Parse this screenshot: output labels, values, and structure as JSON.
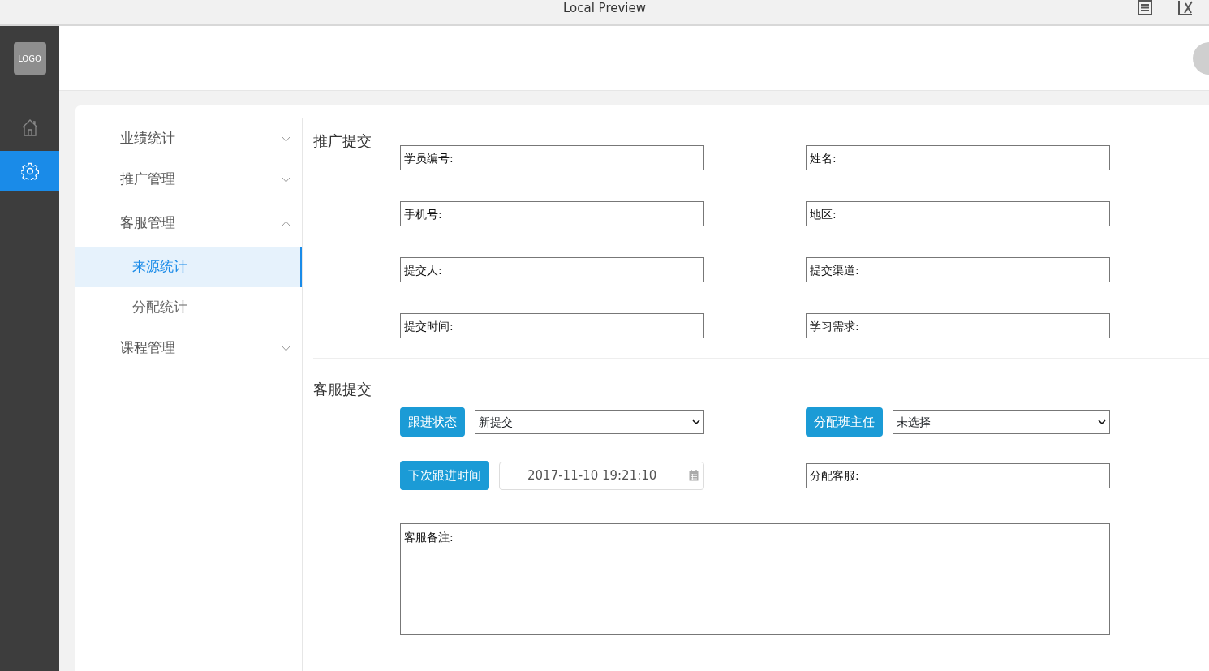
{
  "window": {
    "title": "Local Preview"
  },
  "sidebar": {
    "logo": "LOGO",
    "items": [
      {
        "kind": "home",
        "selected": false
      },
      {
        "kind": "settings",
        "selected": true
      }
    ]
  },
  "menu": [
    {
      "label": "业绩统计",
      "expanded": false
    },
    {
      "label": "推广管理",
      "expanded": false
    },
    {
      "label": "客服管理",
      "expanded": true,
      "children": [
        {
          "label": "来源统计",
          "selected": true
        },
        {
          "label": "分配统计",
          "selected": false
        }
      ]
    },
    {
      "label": "课程管理",
      "expanded": false
    }
  ],
  "promotion": {
    "title": "推广提交",
    "fields": [
      {
        "placeholder": "学员编号:"
      },
      {
        "placeholder": "姓名:"
      },
      {
        "placeholder": "手机号:"
      },
      {
        "placeholder": "地区:"
      },
      {
        "placeholder": "提交人:"
      },
      {
        "placeholder": "提交渠道:"
      },
      {
        "placeholder": "提交时间:"
      },
      {
        "placeholder": "学习需求:"
      }
    ]
  },
  "service": {
    "title": "客服提交",
    "controls": [
      {
        "kind": "select",
        "button": "跟进状态",
        "value": "新提交"
      },
      {
        "kind": "select",
        "button": "分配班主任",
        "value": "未选择"
      },
      {
        "kind": "date",
        "button": "下次跟进时间",
        "value": "2017-11-10 19:21:10"
      },
      {
        "kind": "text",
        "placeholder": "分配客服:"
      }
    ],
    "notes": {
      "placeholder": "客服备注:"
    }
  }
}
